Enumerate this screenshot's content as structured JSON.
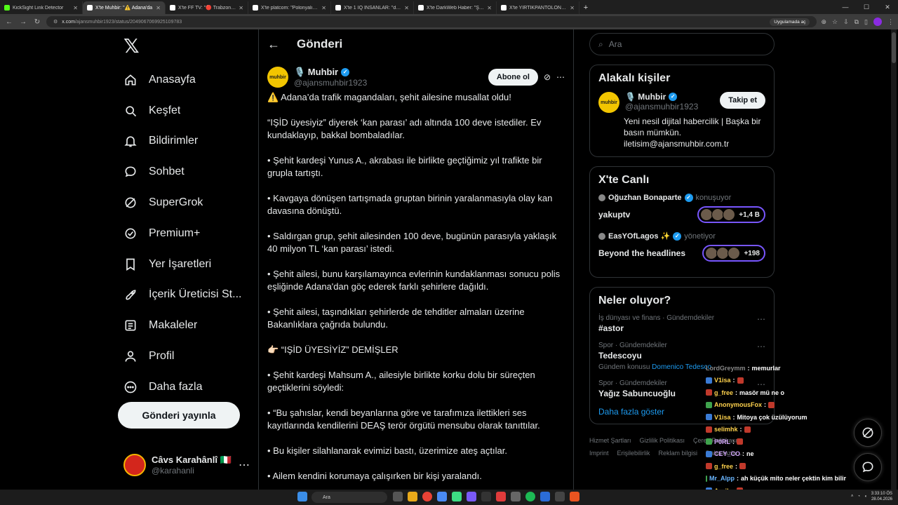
{
  "browser": {
    "tabs": [
      {
        "title": "KickSight Link Detector",
        "color": "#53fc18",
        "active": false
      },
      {
        "title": "X'te Muhbir: \"⚠️ Adana'da",
        "color": "#ffffff",
        "active": true
      },
      {
        "title": "X'te FF TV: \"🔴 Trabzon'da saha",
        "color": "#ffffff",
        "active": false
      },
      {
        "title": "X'te platcom: \"Polonyalı yayıncı",
        "color": "#ffffff",
        "active": false
      },
      {
        "title": "X'te 1 IQ İNSANLAR: \"durduk y",
        "color": "#ffffff",
        "active": false
      },
      {
        "title": "X'te DarkWeb Haber: \"Şırnak'ta",
        "color": "#ffffff",
        "active": false
      },
      {
        "title": "X'te YIRTIKPANTOLON: \"Bazen",
        "color": "#ffffff",
        "active": false
      }
    ],
    "url_host": "x.com",
    "url_path": "/ajansmuhbir1923/status/2049067069925109783",
    "app_label": "Uygulamada aç"
  },
  "nav": {
    "logo": "𝕏",
    "items": [
      {
        "label": "Anasayfa",
        "icon": "home-icon"
      },
      {
        "label": "Keşfet",
        "icon": "search-icon"
      },
      {
        "label": "Bildirimler",
        "icon": "bell-icon"
      },
      {
        "label": "Sohbet",
        "icon": "chat-icon"
      },
      {
        "label": "SuperGrok",
        "icon": "grok-icon"
      },
      {
        "label": "Premium+",
        "icon": "premium-icon"
      },
      {
        "label": "Yer İşaretleri",
        "icon": "bookmark-icon"
      },
      {
        "label": "İçerik Üreticisi St...",
        "icon": "rocket-icon"
      },
      {
        "label": "Makaleler",
        "icon": "article-icon"
      },
      {
        "label": "Profil",
        "icon": "person-icon"
      },
      {
        "label": "Daha fazla",
        "icon": "more-circle-icon"
      }
    ],
    "post_button": "Gönderi yayınla",
    "account": {
      "name": "Câvs Karahânlî 🇮🇹",
      "handle": "@karahanli"
    }
  },
  "post": {
    "header_title": "Gönderi",
    "author_name": "🎙️ Muhbir",
    "author_handle": "@ajansmuhbir1923",
    "avatar_text": "muhbir",
    "subscribe": "Abone ol",
    "paragraphs": [
      "⚠️ Adana’da trafik magandaları, şehit ailesine musallat oldu!",
      "“IŞİD üyesiyiz” diyerek ‘kan parası’ adı altında 100 deve istediler. Ev kundaklayıp, bakkal bombaladılar.",
      "• Şehit kardeşi Yunus A., akrabası ile birlikte geçtiğimiz yıl trafikte bir grupla tartıştı.",
      "• Kavgaya dönüşen tartışmada gruptan birinin yaralanmasıyla olay kan davasına dönüştü.",
      "• Saldırgan grup, şehit ailesinden 100 deve, bugünün parasıyla yaklaşık 40 milyon TL ‘kan parası’ istedi.",
      "• Şehit ailesi, bunu karşılamayınca evlerinin kundaklanması sonucu polis eşliğinde Adana'dan göç ederek farklı şehirlere dağıldı.",
      "• Şehit ailesi, taşındıkları şehirlerde de tehditler almaları üzerine Bakanlıklara çağrıda bulundu.",
      "👉🏻 “IŞİD ÜYESİYİZ” DEMİŞLER",
      "• Şehit kardeşi Mahsum A., ailesiyle birlikte korku dolu bir süreçten geçtiklerini söyledi:",
      "• “Bu şahıslar, kendi beyanlarına göre ve tarafımıza ilettikleri ses kayıtlarında kendilerini DEAŞ terör örgütü mensubu olarak tanıttılar.",
      "• Bu kişiler silahlanarak evimizi bastı, üzerimize ateş açtılar.",
      "• Ailem kendini korumaya çalışırken bir kişi yaralandı."
    ]
  },
  "sidebar": {
    "search_placeholder": "Ara",
    "related": {
      "title": "Alakalı kişiler",
      "name": "🎙️ Muhbir",
      "handle": "@ajansmuhbir1923",
      "follow": "Takip et",
      "bio": "Yeni nesil dijital habercilik | Başka bir basın mümkün. iletisim@ajansmuhbir.com.tr"
    },
    "live": {
      "title": "X'te Canlı",
      "items": [
        {
          "host": "Oğuzhan Bonaparte",
          "status": "konuşuyor",
          "name": "yakuptv",
          "count": "+1,4 B"
        },
        {
          "host": "EasYOfLagos ✨",
          "status": "yönetiyor",
          "name": "Beyond the headlines",
          "count": "+198"
        }
      ]
    },
    "trends": {
      "title": "Neler oluyor?",
      "items": [
        {
          "cat": "İş dünyası ve finans · Gündemdekiler",
          "title": "#astor",
          "sub_prefix": "",
          "sub_link": ""
        },
        {
          "cat": "Spor · Gündemdekiler",
          "title": "Tedescoyu",
          "sub_prefix": "Gündem konusu",
          "sub_link": "Domenico Tedesco"
        },
        {
          "cat": "Spor · Gündemdekiler",
          "title": "Yağız Sabuncuoğlu",
          "sub_prefix": "",
          "sub_link": ""
        }
      ],
      "show_more": "Daha fazla göster"
    },
    "footer": [
      "Hizmet Şartları",
      "Gizlilik Politikası",
      "Çerez Politikası",
      "Imprint",
      "Erişilebilirlik",
      "Reklam bilgisi",
      "Daha fazla ..."
    ]
  },
  "chat": [
    {
      "user": "LordGreymm",
      "msg": "memurlar",
      "cls": "gray"
    },
    {
      "user": "V1isa",
      "msg": "",
      "cls": ""
    },
    {
      "user": "g_free",
      "msg": "masör mü ne o",
      "cls": ""
    },
    {
      "user": "AnonymousFox",
      "msg": "",
      "cls": ""
    },
    {
      "user": "V1isa",
      "msg": "Mitoya çok üzülüyorum",
      "cls": ""
    },
    {
      "user": "selimhk",
      "msg": "",
      "cls": ""
    },
    {
      "user": "P0RL",
      "msg": "",
      "cls": "purple"
    },
    {
      "user": "CEY_CO",
      "msg": "ne",
      "cls": "purple"
    },
    {
      "user": "g_free",
      "msg": "",
      "cls": ""
    },
    {
      "user": "Mr_Alpp",
      "msg": "ah küçük mito neler çektin kim bilir",
      "cls": "blue"
    },
    {
      "user": "Azzik",
      "msg": "",
      "cls": ""
    }
  ],
  "taskbar": {
    "search": "Ara",
    "time": "3:33:10 ÖS",
    "date": "28.04.2026"
  }
}
